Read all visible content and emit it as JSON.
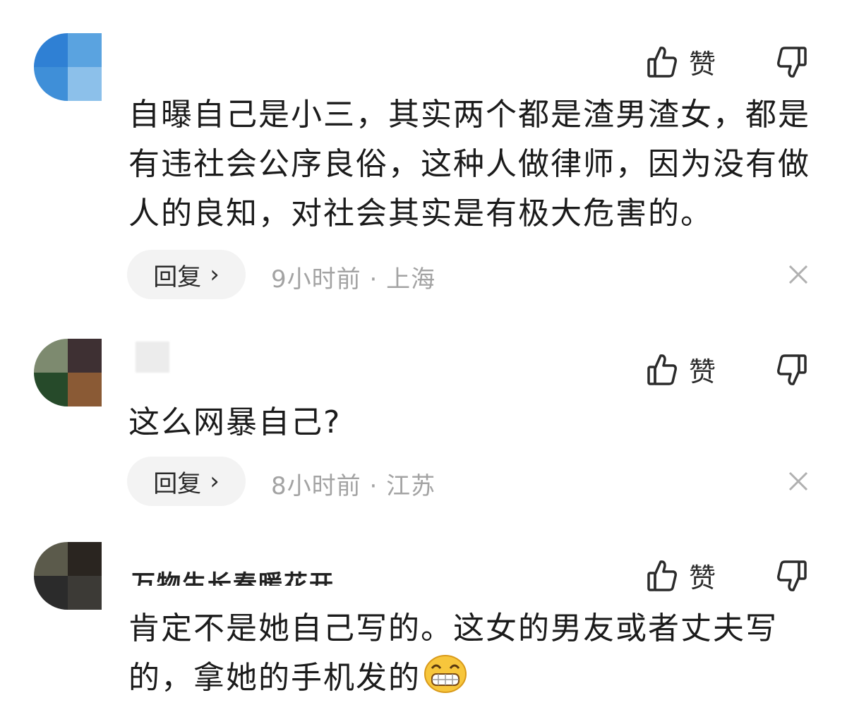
{
  "comments": [
    {
      "username": "",
      "like_label": "赞",
      "text": "自曝自己是小三，其实两个都是渣男渣女，都是有违社会公序良俗，这种人做律师，因为没有做人的良知，对社会其实是有极大危害的。",
      "reply_label": "回复",
      "reply_chevron": "›",
      "time": "9小时前",
      "separator": "·",
      "location": "上海",
      "avatar_colors": [
        "#2f80d4",
        "#5aa3e0",
        "#3f8fd8",
        "#8cc0ea"
      ]
    },
    {
      "username": "",
      "like_label": "赞",
      "text": "这么网暴自己?",
      "reply_label": "回复",
      "reply_chevron": "›",
      "time": "8小时前",
      "separator": "·",
      "location": "江苏",
      "avatar_colors": [
        "#7d8a6f",
        "#3e3033",
        "#264a2a",
        "#8a5a35"
      ]
    },
    {
      "username": "万物生长春暖花开",
      "like_label": "赞",
      "text": "肯定不是她自己写的。这女的男友或者丈夫写的，拿她的手机发的",
      "emoji": "grinning-face-icon",
      "avatar_colors": [
        "#5b5a4b",
        "#2a2520",
        "#2b2b2b",
        "#3c3a36"
      ]
    }
  ]
}
